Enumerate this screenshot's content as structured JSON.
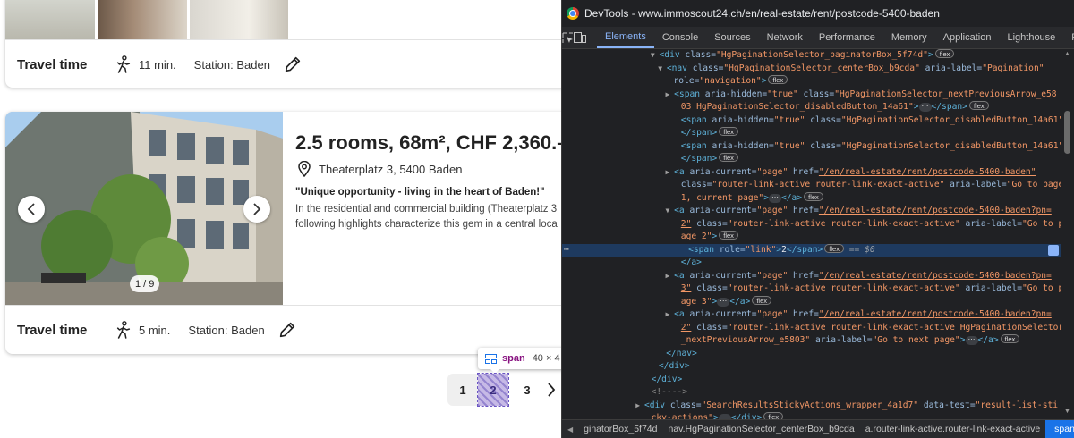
{
  "devtools": {
    "title": "DevTools - www.immoscout24.ch/en/real-estate/rent/postcode-5400-baden",
    "tabs": [
      "Elements",
      "Console",
      "Sources",
      "Network",
      "Performance",
      "Memory",
      "Application",
      "Lighthouse",
      "Re"
    ],
    "active_tab": "Elements",
    "breadcrumbs": [
      "ginatorBox_5f74d",
      "nav.HgPaginationSelector_centerBox_b9cda",
      "a.router-link-active.router-link-exact-active",
      "span"
    ],
    "tree": [
      {
        "indent": 13,
        "arrow": "▼",
        "parts": [
          [
            "tg",
            "<div"
          ],
          [
            "an",
            " class="
          ],
          [
            "av",
            "\"HgPaginationSelector_paginatorBox_5f74d\""
          ],
          [
            "tg",
            ">"
          ]
        ],
        "badge": "flex"
      },
      {
        "indent": 14,
        "arrow": "▼",
        "parts": [
          [
            "tg",
            "<nav"
          ],
          [
            "an",
            " class="
          ],
          [
            "av",
            "\"HgPaginationSelector_centerBox_b9cda\""
          ],
          [
            "an",
            " aria-label="
          ],
          [
            "av",
            "\"Pagination\""
          ]
        ]
      },
      {
        "indent": 15,
        "parts": [
          [
            "an",
            "role="
          ],
          [
            "av",
            "\"navigation\""
          ],
          [
            "tg",
            ">"
          ]
        ],
        "badge": "flex"
      },
      {
        "indent": 15,
        "arrow": "▶",
        "parts": [
          [
            "tg",
            "<span"
          ],
          [
            "an",
            " aria-hidden="
          ],
          [
            "av",
            "\"true\""
          ],
          [
            "an",
            " class="
          ],
          [
            "av",
            "\"HgPaginationSelector_nextPreviousArrow_e58"
          ]
        ]
      },
      {
        "indent": 16,
        "parts": [
          [
            "av",
            "03 HgPaginationSelector_disabledButton_14a61\""
          ],
          [
            "tg",
            ">"
          ]
        ],
        "ell": true,
        "after": [
          [
            "tg",
            "</span>"
          ]
        ],
        "badge": "flex"
      },
      {
        "indent": 16,
        "parts": [
          [
            "tg",
            "<span"
          ],
          [
            "an",
            " aria-hidden="
          ],
          [
            "av",
            "\"true\""
          ],
          [
            "an",
            " class="
          ],
          [
            "av",
            "\"HgPaginationSelector_disabledButton_14a61\""
          ],
          [
            "tg",
            ">"
          ]
        ]
      },
      {
        "indent": 16,
        "parts": [
          [
            "tg",
            "</span>"
          ]
        ],
        "badge": "flex"
      },
      {
        "indent": 16,
        "parts": [
          [
            "tg",
            "<span"
          ],
          [
            "an",
            " aria-hidden="
          ],
          [
            "av",
            "\"true\""
          ],
          [
            "an",
            " class="
          ],
          [
            "av",
            "\"HgPaginationSelector_disabledButton_14a61\""
          ],
          [
            "tg",
            ">"
          ]
        ]
      },
      {
        "indent": 16,
        "parts": [
          [
            "tg",
            "</span>"
          ]
        ],
        "badge": "flex"
      },
      {
        "indent": 15,
        "arrow": "▶",
        "parts": [
          [
            "tg",
            "<a"
          ],
          [
            "an",
            " aria-current="
          ],
          [
            "av",
            "\"page\""
          ],
          [
            "an",
            " href="
          ],
          [
            "lk",
            "\"/en/real-estate/rent/postcode-5400-baden\""
          ]
        ]
      },
      {
        "indent": 16,
        "parts": [
          [
            "an",
            "class="
          ],
          [
            "av",
            "\"router-link-active router-link-exact-active\""
          ],
          [
            "an",
            " aria-label="
          ],
          [
            "av",
            "\"Go to page"
          ]
        ]
      },
      {
        "indent": 16,
        "parts": [
          [
            "av",
            "1, current page\""
          ],
          [
            "tg",
            ">"
          ]
        ],
        "ell": true,
        "after": [
          [
            "tg",
            "</a>"
          ]
        ],
        "badge": "flex"
      },
      {
        "indent": 15,
        "arrow": "▼",
        "parts": [
          [
            "tg",
            "<a"
          ],
          [
            "an",
            " aria-current="
          ],
          [
            "av",
            "\"page\""
          ],
          [
            "an",
            " href="
          ],
          [
            "lk",
            "\"/en/real-estate/rent/postcode-5400-baden?pn="
          ]
        ]
      },
      {
        "indent": 16,
        "parts": [
          [
            "lk",
            "2\""
          ],
          [
            "an",
            " class="
          ],
          [
            "av",
            "\"router-link-active router-link-exact-active\""
          ],
          [
            "an",
            " aria-label="
          ],
          [
            "av",
            "\"Go to p"
          ]
        ]
      },
      {
        "indent": 16,
        "parts": [
          [
            "av",
            "age 2\""
          ],
          [
            "tg",
            ">"
          ]
        ],
        "badge": "flex"
      },
      {
        "indent": 17,
        "sel": true,
        "parts": [
          [
            "tg",
            "<span"
          ],
          [
            "an",
            " role="
          ],
          [
            "av",
            "\"link\""
          ],
          [
            "tg",
            ">"
          ],
          [
            "tx",
            "2"
          ],
          [
            "tg",
            "</span>"
          ]
        ],
        "badge": "flex",
        "dollar": "== $0"
      },
      {
        "indent": 16,
        "parts": [
          [
            "tg",
            "</a>"
          ]
        ]
      },
      {
        "indent": 15,
        "arrow": "▶",
        "parts": [
          [
            "tg",
            "<a"
          ],
          [
            "an",
            " aria-current="
          ],
          [
            "av",
            "\"page\""
          ],
          [
            "an",
            " href="
          ],
          [
            "lk",
            "\"/en/real-estate/rent/postcode-5400-baden?pn="
          ]
        ]
      },
      {
        "indent": 16,
        "parts": [
          [
            "lk",
            "3\""
          ],
          [
            "an",
            " class="
          ],
          [
            "av",
            "\"router-link-active router-link-exact-active\""
          ],
          [
            "an",
            " aria-label="
          ],
          [
            "av",
            "\"Go to p"
          ]
        ]
      },
      {
        "indent": 16,
        "parts": [
          [
            "av",
            "age 3\""
          ],
          [
            "tg",
            ">"
          ]
        ],
        "ell": true,
        "after": [
          [
            "tg",
            "</a>"
          ]
        ],
        "badge": "flex"
      },
      {
        "indent": 15,
        "arrow": "▶",
        "parts": [
          [
            "tg",
            "<a"
          ],
          [
            "an",
            " aria-current="
          ],
          [
            "av",
            "\"page\""
          ],
          [
            "an",
            " href="
          ],
          [
            "lk",
            "\"/en/real-estate/rent/postcode-5400-baden?pn="
          ]
        ]
      },
      {
        "indent": 16,
        "parts": [
          [
            "lk",
            "2\""
          ],
          [
            "an",
            " class="
          ],
          [
            "av",
            "\"router-link-active router-link-exact-active HgPaginationSelector"
          ]
        ]
      },
      {
        "indent": 16,
        "parts": [
          [
            "av",
            "_nextPreviousArrow_e5803\""
          ],
          [
            "an",
            " aria-label="
          ],
          [
            "av",
            "\"Go to next page\""
          ],
          [
            "tg",
            ">"
          ]
        ],
        "ell": true,
        "after": [
          [
            "tg",
            "</a>"
          ]
        ],
        "badge": "flex"
      },
      {
        "indent": 14,
        "parts": [
          [
            "tg",
            "</nav>"
          ]
        ]
      },
      {
        "indent": 13,
        "parts": [
          [
            "tg",
            "</div>"
          ]
        ]
      },
      {
        "indent": 12,
        "parts": [
          [
            "tg",
            "</div>"
          ]
        ]
      },
      {
        "indent": 12,
        "parts": [
          [
            "cm",
            "<!---->"
          ]
        ]
      },
      {
        "indent": 11,
        "arrow": "▶",
        "parts": [
          [
            "tg",
            "<div"
          ],
          [
            "an",
            " class="
          ],
          [
            "av",
            "\"SearchResultsStickyActions_wrapper_4a1d7\""
          ],
          [
            "an",
            " data-test="
          ],
          [
            "av",
            "\"result-list-sti"
          ]
        ]
      },
      {
        "indent": 12,
        "parts": [
          [
            "av",
            "cky-actions\""
          ],
          [
            "tg",
            ">"
          ]
        ],
        "ell": true,
        "after": [
          [
            "tg",
            "</div>"
          ]
        ],
        "badge": "flex"
      }
    ]
  },
  "listing_top": {
    "travel_label": "Travel time",
    "minutes": "11 min.",
    "station": "Station: Baden"
  },
  "listing": {
    "title": "2.5 rooms, 68m², CHF 2,360.–",
    "address": "Theaterplatz 3, 5400 Baden",
    "teaser": "\"Unique opportunity - living in the heart of Baden!\"",
    "desc_line1": "In the residential and commercial building (Theaterplatz 3",
    "desc_line2": "following highlights characterize this gem in a central loca",
    "counter": "1 / 9",
    "travel_label": "Travel time",
    "minutes": "5 min.",
    "station": "Station: Baden"
  },
  "pagination": {
    "page1": "1",
    "page2": "2",
    "page3": "3"
  },
  "inspector_tooltip": {
    "tag": "span",
    "dims": "40 × 4"
  }
}
